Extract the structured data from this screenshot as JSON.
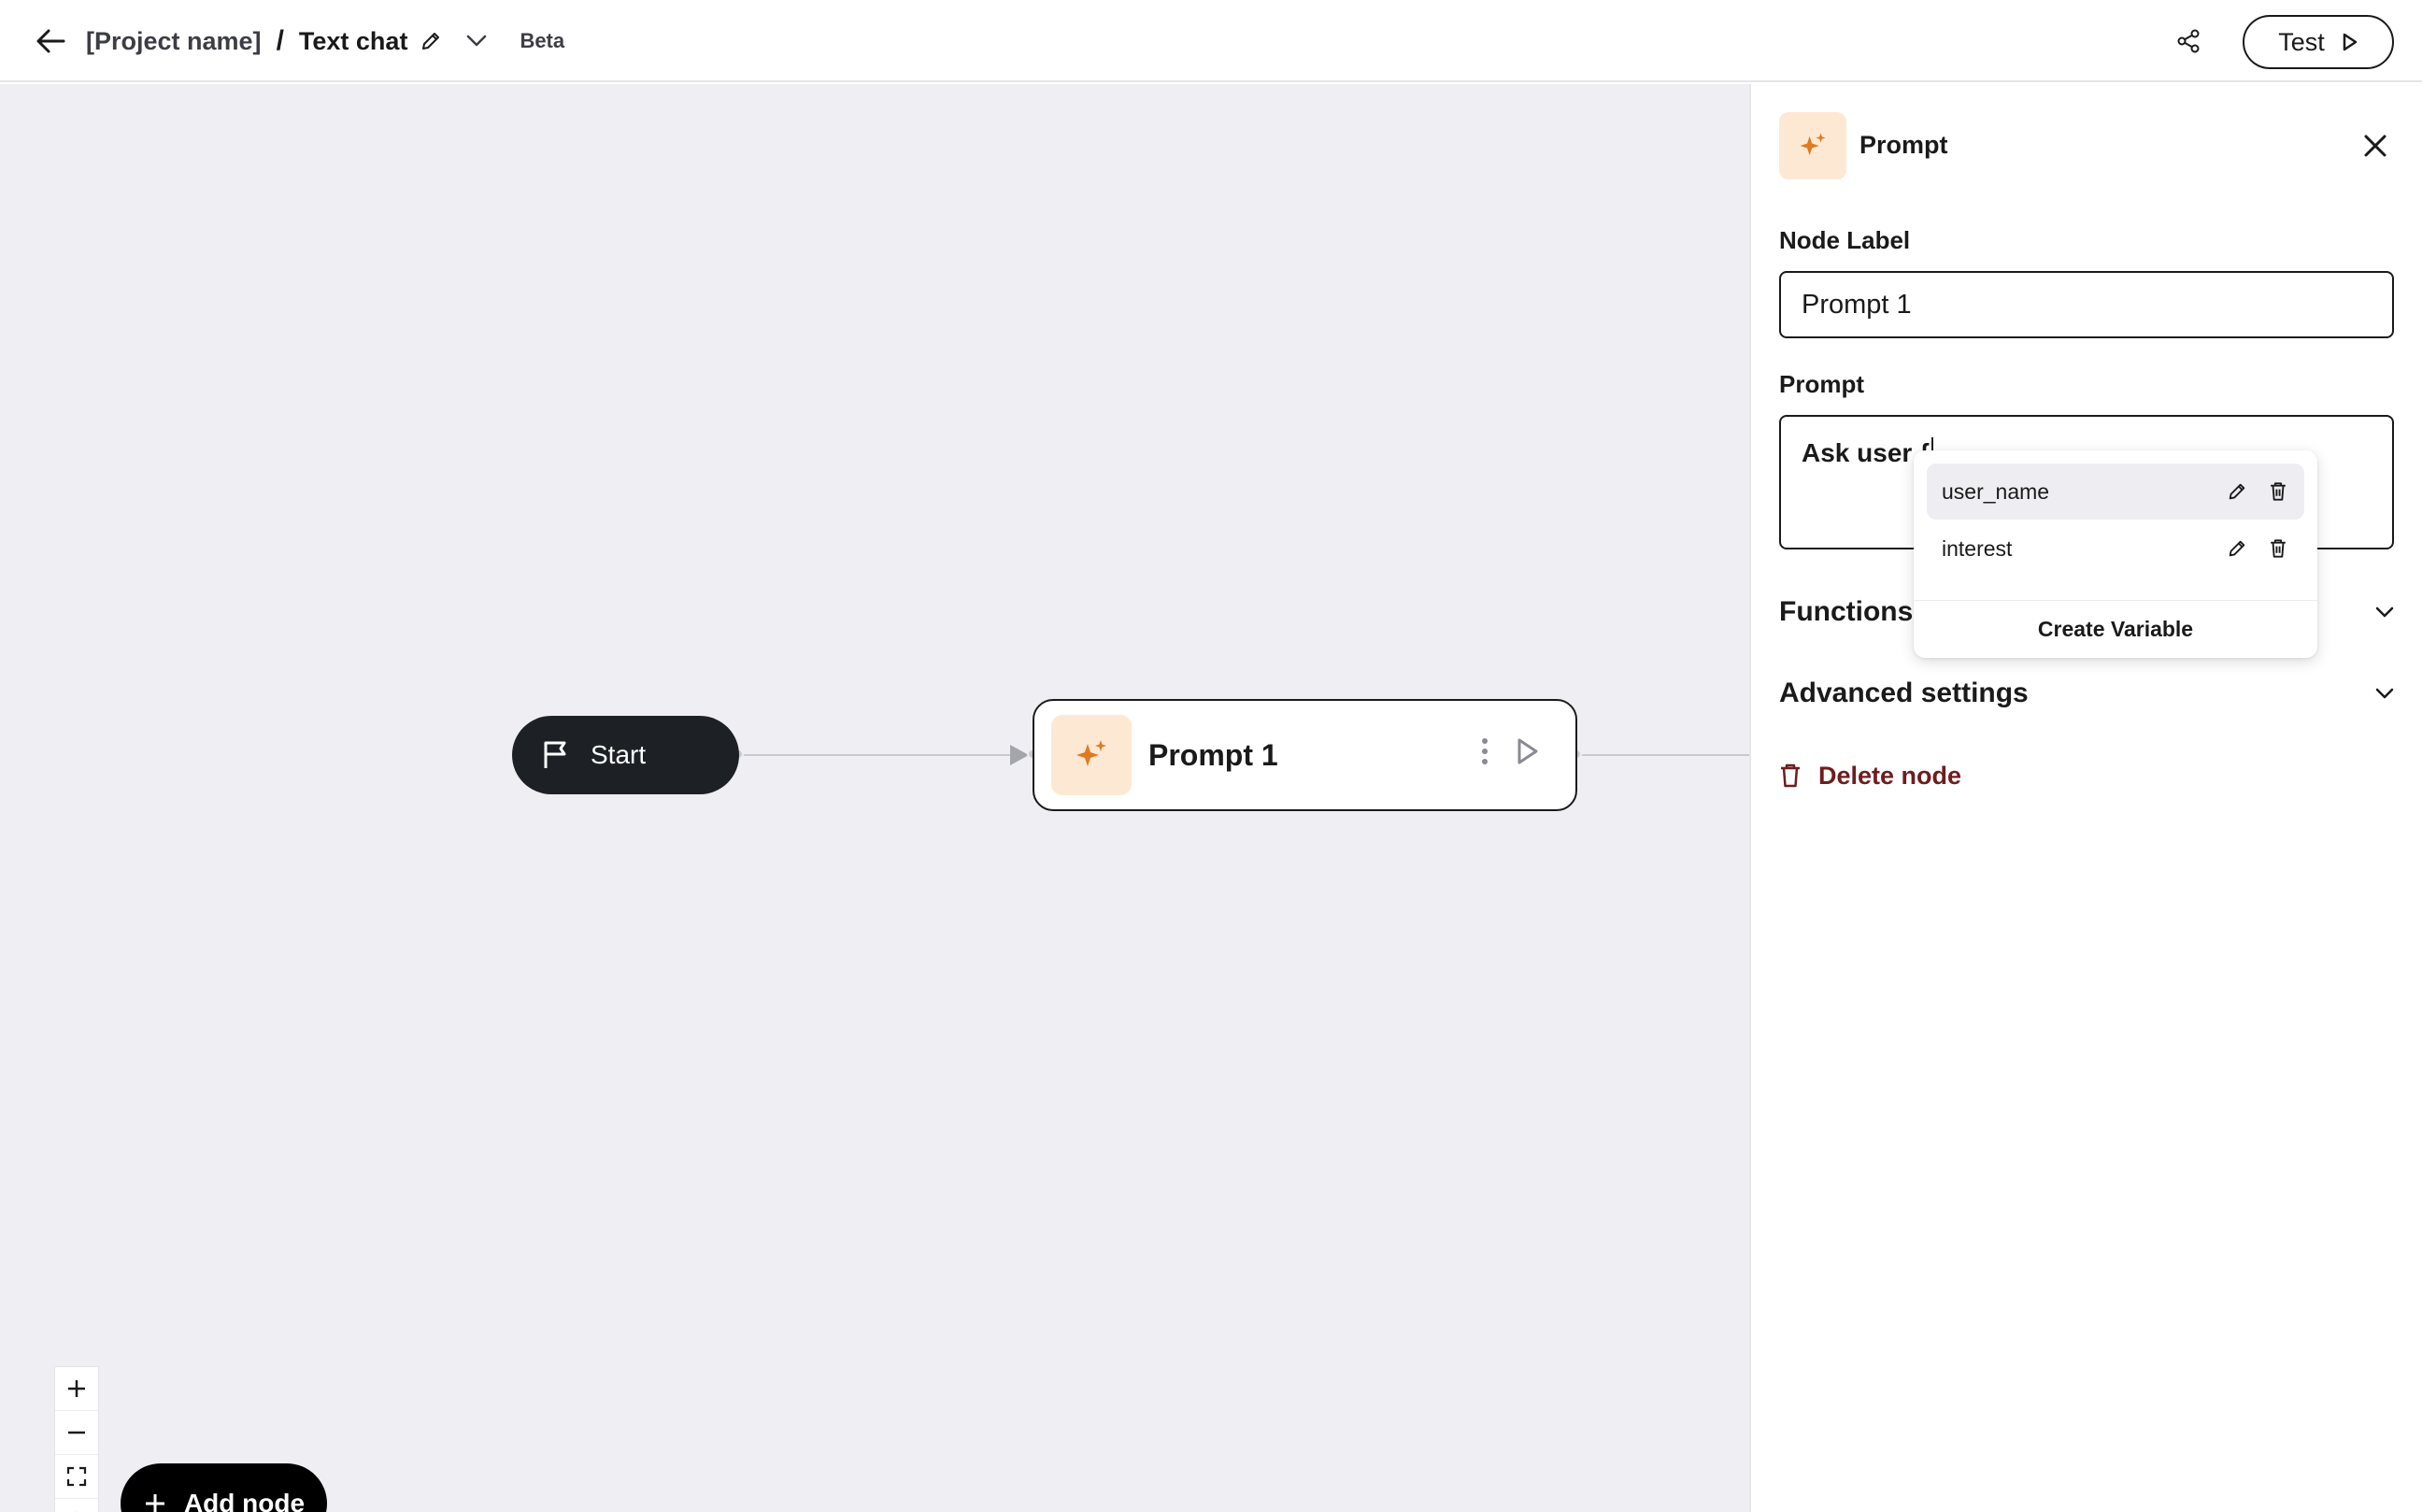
{
  "header": {
    "project_name": "[Project name]",
    "separator": "/",
    "current_page": "Text chat",
    "beta_label": "Beta",
    "test_label": "Test"
  },
  "canvas": {
    "start_label": "Start",
    "prompt_node_label": "Prompt 1",
    "add_node_label": "Add node"
  },
  "panel": {
    "title": "Prompt",
    "node_label_heading": "Node Label",
    "node_label_value": "Prompt 1",
    "prompt_heading": "Prompt",
    "prompt_text": "Ask user {",
    "functions_label": "Functions",
    "advanced_label": "Advanced settings",
    "delete_label": "Delete node"
  },
  "variables": {
    "items": [
      "user_name",
      "interest"
    ],
    "create_label": "Create Variable"
  },
  "colors": {
    "accent_orange": "#e07a1f",
    "icon_bg": "#fde9d3",
    "canvas_bg": "#efeef3",
    "delete_red": "#6e1d1d"
  }
}
